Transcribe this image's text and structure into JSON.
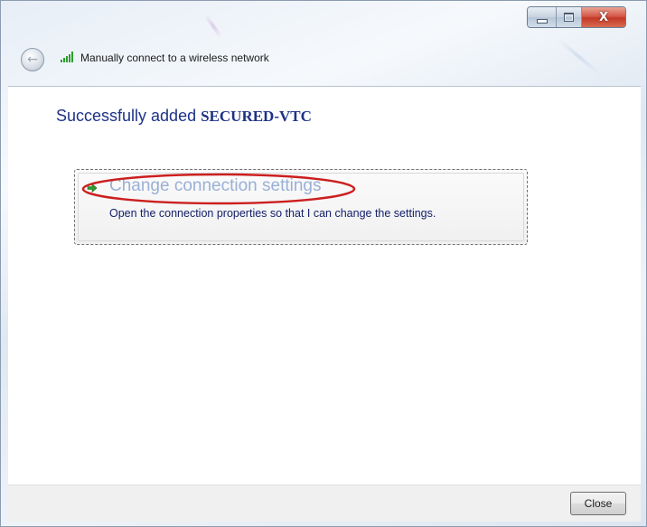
{
  "window": {
    "title": "Manually connect to a wireless network",
    "close_glyph": "X"
  },
  "content": {
    "heading_prefix": "Successfully added ",
    "network_name": "SECURED-VTC"
  },
  "command_link": {
    "title": "Change connection settings",
    "description": "Open the connection properties so that I can change the settings.",
    "annotation_color": "#cc1f1f"
  },
  "footer": {
    "close_label": "Close"
  },
  "icons": [
    "back-arrow-icon",
    "wireless-signal-icon",
    "green-arrow-icon",
    "minimize-icon",
    "maximize-icon",
    "close-icon"
  ]
}
